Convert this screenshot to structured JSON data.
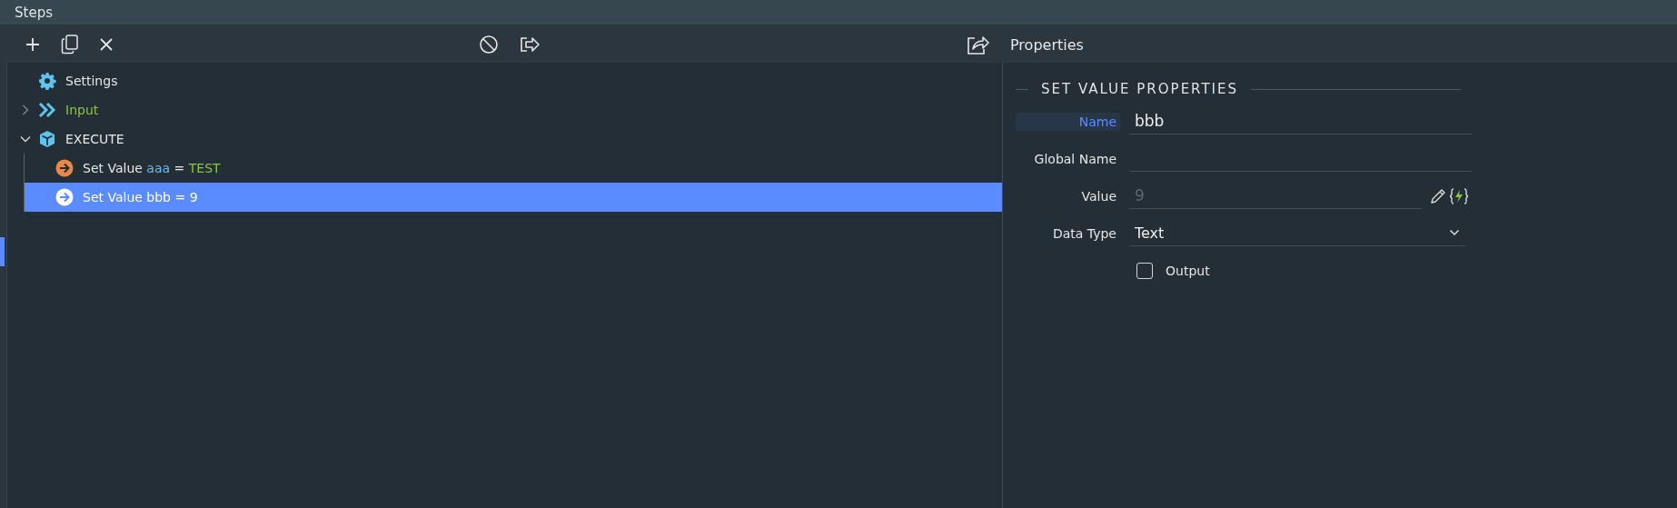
{
  "header": {
    "title": "Steps"
  },
  "properties_title": "Properties",
  "tree": [
    {
      "kind": "settings",
      "label": "Settings",
      "selected": false
    },
    {
      "kind": "input",
      "label": "Input",
      "expanded": false,
      "selected": false
    },
    {
      "kind": "group",
      "label": "EXECUTE",
      "expanded": true,
      "selected": false,
      "children": [
        {
          "kind": "step",
          "action": "Set Value",
          "variable": "aaa",
          "operator": "=",
          "value": "TEST",
          "value_literal": true,
          "selected": false
        },
        {
          "kind": "step",
          "action": "Set Value",
          "variable": "bbb",
          "operator": "=",
          "value": "9",
          "selected": true
        }
      ]
    }
  ],
  "section": {
    "title": "SET VALUE PROPERTIES"
  },
  "form": [
    {
      "kind": "text",
      "label": "Name",
      "value": "bbb",
      "focused": true
    },
    {
      "kind": "text",
      "label": "Global Name",
      "focused": false
    },
    {
      "kind": "expression",
      "label": "Value",
      "placeholder": "9",
      "focused": false
    },
    {
      "kind": "select",
      "label": "Data Type",
      "value": "Text",
      "focused": false
    },
    {
      "kind": "checkbox",
      "label": "Output",
      "checked": false
    }
  ]
}
